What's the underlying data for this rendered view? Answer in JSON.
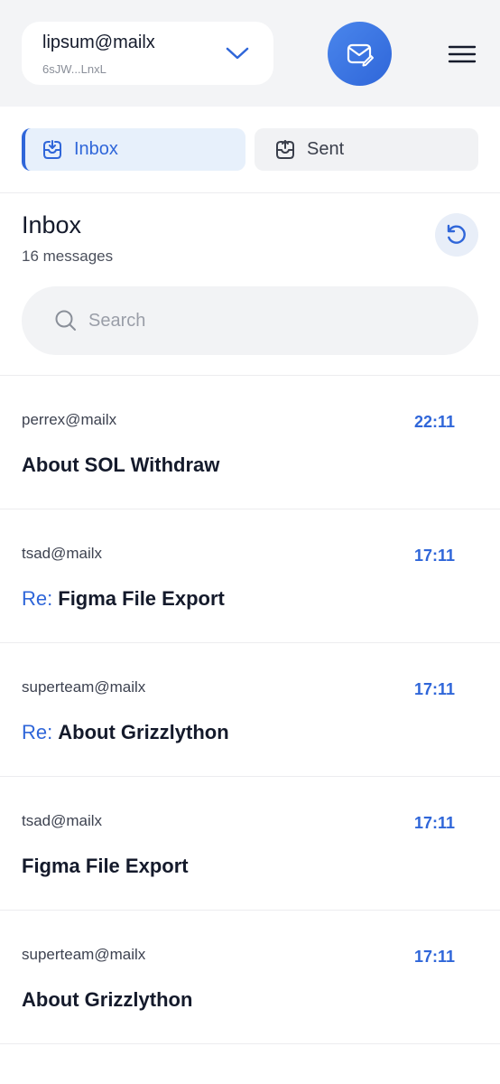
{
  "account": {
    "email": "lipsum@mailx",
    "address": "6sJW...LnxL"
  },
  "tabs": [
    {
      "label": "Inbox",
      "active": true
    },
    {
      "label": "Sent",
      "active": false
    }
  ],
  "inbox": {
    "title": "Inbox",
    "count": "16 messages"
  },
  "search": {
    "placeholder": "Search"
  },
  "messages": [
    {
      "from": "perrex@mailx",
      "time": "22:11",
      "prefix": "",
      "subject": "About SOL Withdraw"
    },
    {
      "from": "tsad@mailx",
      "time": "17:11",
      "prefix": "Re:",
      "subject": "Figma File Export"
    },
    {
      "from": "superteam@mailx",
      "time": "17:11",
      "prefix": "Re:",
      "subject": "About Grizzlython"
    },
    {
      "from": "tsad@mailx",
      "time": "17:11",
      "prefix": "",
      "subject": "Figma File Export"
    },
    {
      "from": "superteam@mailx",
      "time": "17:11",
      "prefix": "",
      "subject": "About Grizzlython"
    }
  ],
  "colors": {
    "accent": "#2f66d9",
    "background_top": "#f3f4f6"
  },
  "icons": {
    "chevron": "chevron-down-icon",
    "compose": "compose-mail-icon",
    "menu": "hamburger-menu-icon",
    "inbox": "inbox-tray-icon",
    "sent": "sent-tray-icon",
    "refresh": "refresh-icon",
    "search": "search-icon"
  }
}
